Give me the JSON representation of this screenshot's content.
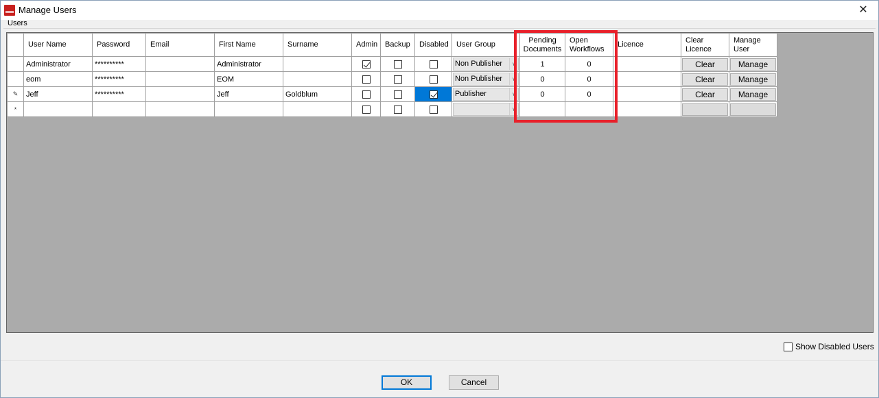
{
  "window": {
    "title": "Manage Users",
    "close_glyph": "✕",
    "icon": "smart-app-icon",
    "icon_color": "#c8201e"
  },
  "group_label": "Users",
  "columns": {
    "user_name": "User Name",
    "password": "Password",
    "email": "Email",
    "first_name": "First Name",
    "surname": "Surname",
    "admin": "Admin",
    "backup": "Backup",
    "disabled": "Disabled",
    "user_group": "User Group",
    "pending_line1": "Pending",
    "pending_line2": "Documents",
    "open_line1": "Open",
    "open_line2": "Workflows",
    "licence": "Licence",
    "clear_line1": "Clear",
    "clear_line2": "Licence",
    "manage_line1": "Manage",
    "manage_line2": "User"
  },
  "rows": [
    {
      "row_marker": "",
      "user_name": "Administrator",
      "password": "**********",
      "email": "",
      "first_name": "Administrator",
      "surname": "",
      "admin": true,
      "backup": false,
      "disabled": false,
      "user_group": "Non Publisher",
      "pending_documents": "1",
      "open_workflows": "0",
      "licence": "",
      "clear_label": "Clear",
      "manage_label": "Manage"
    },
    {
      "row_marker": "",
      "user_name": "eom",
      "password": "**********",
      "email": "",
      "first_name": "EOM",
      "surname": "",
      "admin": false,
      "backup": false,
      "disabled": false,
      "user_group": "Non Publisher",
      "pending_documents": "0",
      "open_workflows": "0",
      "licence": "",
      "clear_label": "Clear",
      "manage_label": "Manage"
    },
    {
      "row_marker": "✎",
      "user_name": "Jeff",
      "password": "**********",
      "email": "",
      "first_name": "Jeff",
      "surname": "Goldblum",
      "admin": false,
      "backup": false,
      "disabled": true,
      "user_group": "Publisher",
      "pending_documents": "0",
      "open_workflows": "0",
      "licence": "",
      "clear_label": "Clear",
      "manage_label": "Manage"
    }
  ],
  "new_row_marker": "*",
  "highlight_color": "#e8202a",
  "selection_color": "#0078d7",
  "show_disabled_label": "Show Disabled Users",
  "show_disabled_checked": false,
  "ok_label": "OK",
  "cancel_label": "Cancel"
}
